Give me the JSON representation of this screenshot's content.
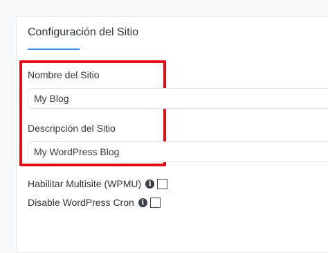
{
  "section": {
    "title": "Configuración del Sitio"
  },
  "fields": {
    "site_name": {
      "label": "Nombre del Sitio",
      "value": "My Blog"
    },
    "site_description": {
      "label": "Descripción del Sitio",
      "value": "My WordPress Blog"
    }
  },
  "options": [
    {
      "label": "Habilitar Multisite (WPMU)",
      "info_icon": "info-icon",
      "checked": false
    },
    {
      "label": "Disable WordPress Cron",
      "info_icon": "info-icon",
      "checked": false
    }
  ],
  "colors": {
    "accent": "#3b8be6",
    "highlight": "#e10d17"
  }
}
